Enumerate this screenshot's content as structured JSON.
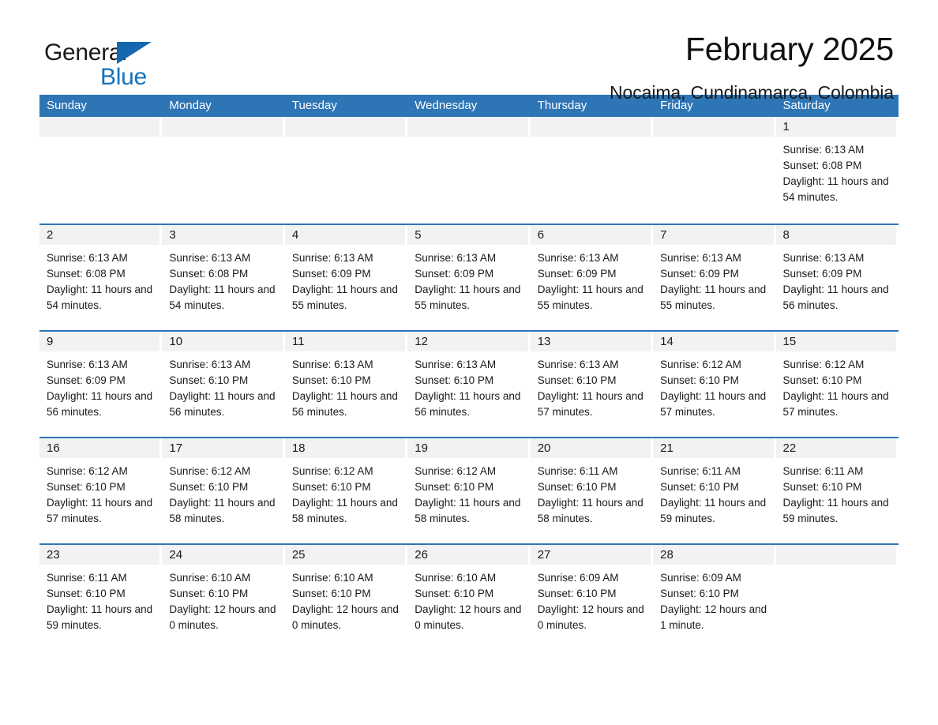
{
  "logo": {
    "word_one": "General",
    "word_two": "Blue",
    "triangle_icon": "triangle-icon",
    "triangle_color": "#1568b0",
    "blue_text_color": "#1472bb"
  },
  "header": {
    "title": "February 2025",
    "subtitle": "Nocaima, Cundinamarca, Colombia"
  },
  "colors": {
    "header_band": "#2e75b6",
    "row_separator": "#2e75b6",
    "day_band": "#f2f2f2",
    "text": "#1a1a1a"
  },
  "calendar": {
    "weekdays": [
      "Sunday",
      "Monday",
      "Tuesday",
      "Wednesday",
      "Thursday",
      "Friday",
      "Saturday"
    ],
    "weeks": [
      [
        {
          "day": "",
          "sunrise": "",
          "sunset": "",
          "daylight": ""
        },
        {
          "day": "",
          "sunrise": "",
          "sunset": "",
          "daylight": ""
        },
        {
          "day": "",
          "sunrise": "",
          "sunset": "",
          "daylight": ""
        },
        {
          "day": "",
          "sunrise": "",
          "sunset": "",
          "daylight": ""
        },
        {
          "day": "",
          "sunrise": "",
          "sunset": "",
          "daylight": ""
        },
        {
          "day": "",
          "sunrise": "",
          "sunset": "",
          "daylight": ""
        },
        {
          "day": "1",
          "sunrise": "Sunrise: 6:13 AM",
          "sunset": "Sunset: 6:08 PM",
          "daylight": "Daylight: 11 hours and 54 minutes."
        }
      ],
      [
        {
          "day": "2",
          "sunrise": "Sunrise: 6:13 AM",
          "sunset": "Sunset: 6:08 PM",
          "daylight": "Daylight: 11 hours and 54 minutes."
        },
        {
          "day": "3",
          "sunrise": "Sunrise: 6:13 AM",
          "sunset": "Sunset: 6:08 PM",
          "daylight": "Daylight: 11 hours and 54 minutes."
        },
        {
          "day": "4",
          "sunrise": "Sunrise: 6:13 AM",
          "sunset": "Sunset: 6:09 PM",
          "daylight": "Daylight: 11 hours and 55 minutes."
        },
        {
          "day": "5",
          "sunrise": "Sunrise: 6:13 AM",
          "sunset": "Sunset: 6:09 PM",
          "daylight": "Daylight: 11 hours and 55 minutes."
        },
        {
          "day": "6",
          "sunrise": "Sunrise: 6:13 AM",
          "sunset": "Sunset: 6:09 PM",
          "daylight": "Daylight: 11 hours and 55 minutes."
        },
        {
          "day": "7",
          "sunrise": "Sunrise: 6:13 AM",
          "sunset": "Sunset: 6:09 PM",
          "daylight": "Daylight: 11 hours and 55 minutes."
        },
        {
          "day": "8",
          "sunrise": "Sunrise: 6:13 AM",
          "sunset": "Sunset: 6:09 PM",
          "daylight": "Daylight: 11 hours and 56 minutes."
        }
      ],
      [
        {
          "day": "9",
          "sunrise": "Sunrise: 6:13 AM",
          "sunset": "Sunset: 6:09 PM",
          "daylight": "Daylight: 11 hours and 56 minutes."
        },
        {
          "day": "10",
          "sunrise": "Sunrise: 6:13 AM",
          "sunset": "Sunset: 6:10 PM",
          "daylight": "Daylight: 11 hours and 56 minutes."
        },
        {
          "day": "11",
          "sunrise": "Sunrise: 6:13 AM",
          "sunset": "Sunset: 6:10 PM",
          "daylight": "Daylight: 11 hours and 56 minutes."
        },
        {
          "day": "12",
          "sunrise": "Sunrise: 6:13 AM",
          "sunset": "Sunset: 6:10 PM",
          "daylight": "Daylight: 11 hours and 56 minutes."
        },
        {
          "day": "13",
          "sunrise": "Sunrise: 6:13 AM",
          "sunset": "Sunset: 6:10 PM",
          "daylight": "Daylight: 11 hours and 57 minutes."
        },
        {
          "day": "14",
          "sunrise": "Sunrise: 6:12 AM",
          "sunset": "Sunset: 6:10 PM",
          "daylight": "Daylight: 11 hours and 57 minutes."
        },
        {
          "day": "15",
          "sunrise": "Sunrise: 6:12 AM",
          "sunset": "Sunset: 6:10 PM",
          "daylight": "Daylight: 11 hours and 57 minutes."
        }
      ],
      [
        {
          "day": "16",
          "sunrise": "Sunrise: 6:12 AM",
          "sunset": "Sunset: 6:10 PM",
          "daylight": "Daylight: 11 hours and 57 minutes."
        },
        {
          "day": "17",
          "sunrise": "Sunrise: 6:12 AM",
          "sunset": "Sunset: 6:10 PM",
          "daylight": "Daylight: 11 hours and 58 minutes."
        },
        {
          "day": "18",
          "sunrise": "Sunrise: 6:12 AM",
          "sunset": "Sunset: 6:10 PM",
          "daylight": "Daylight: 11 hours and 58 minutes."
        },
        {
          "day": "19",
          "sunrise": "Sunrise: 6:12 AM",
          "sunset": "Sunset: 6:10 PM",
          "daylight": "Daylight: 11 hours and 58 minutes."
        },
        {
          "day": "20",
          "sunrise": "Sunrise: 6:11 AM",
          "sunset": "Sunset: 6:10 PM",
          "daylight": "Daylight: 11 hours and 58 minutes."
        },
        {
          "day": "21",
          "sunrise": "Sunrise: 6:11 AM",
          "sunset": "Sunset: 6:10 PM",
          "daylight": "Daylight: 11 hours and 59 minutes."
        },
        {
          "day": "22",
          "sunrise": "Sunrise: 6:11 AM",
          "sunset": "Sunset: 6:10 PM",
          "daylight": "Daylight: 11 hours and 59 minutes."
        }
      ],
      [
        {
          "day": "23",
          "sunrise": "Sunrise: 6:11 AM",
          "sunset": "Sunset: 6:10 PM",
          "daylight": "Daylight: 11 hours and 59 minutes."
        },
        {
          "day": "24",
          "sunrise": "Sunrise: 6:10 AM",
          "sunset": "Sunset: 6:10 PM",
          "daylight": "Daylight: 12 hours and 0 minutes."
        },
        {
          "day": "25",
          "sunrise": "Sunrise: 6:10 AM",
          "sunset": "Sunset: 6:10 PM",
          "daylight": "Daylight: 12 hours and 0 minutes."
        },
        {
          "day": "26",
          "sunrise": "Sunrise: 6:10 AM",
          "sunset": "Sunset: 6:10 PM",
          "daylight": "Daylight: 12 hours and 0 minutes."
        },
        {
          "day": "27",
          "sunrise": "Sunrise: 6:09 AM",
          "sunset": "Sunset: 6:10 PM",
          "daylight": "Daylight: 12 hours and 0 minutes."
        },
        {
          "day": "28",
          "sunrise": "Sunrise: 6:09 AM",
          "sunset": "Sunset: 6:10 PM",
          "daylight": "Daylight: 12 hours and 1 minute."
        },
        {
          "day": "",
          "sunrise": "",
          "sunset": "",
          "daylight": ""
        }
      ]
    ]
  }
}
